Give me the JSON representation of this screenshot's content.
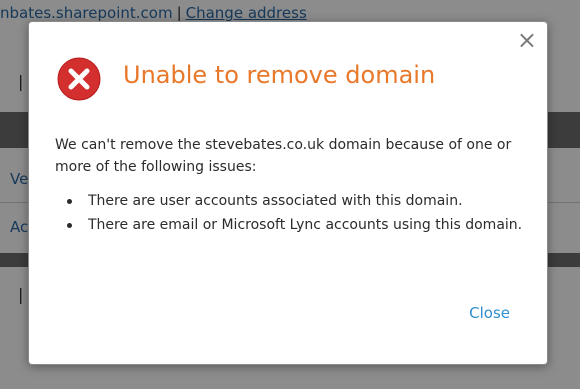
{
  "background": {
    "url_text": "nbates.sharepoint.com",
    "separator": "|",
    "change_address": "Change address",
    "pipe_1": "|",
    "row_1_prefix": "Ve",
    "row_2_prefix": "Ac",
    "pipe_2": "|"
  },
  "dialog": {
    "close_icon": "×",
    "title": "Unable to remove domain",
    "message": "We can't remove the stevebates.co.uk domain because of one or more of the following issues:",
    "issues": [
      "There are user accounts associated with this domain.",
      "There are email or Microsoft Lync accounts using this domain."
    ],
    "close_label": "Close"
  },
  "colors": {
    "title": "#e8782a",
    "link": "#2e8fd0",
    "error_icon": "#d32f2f"
  }
}
